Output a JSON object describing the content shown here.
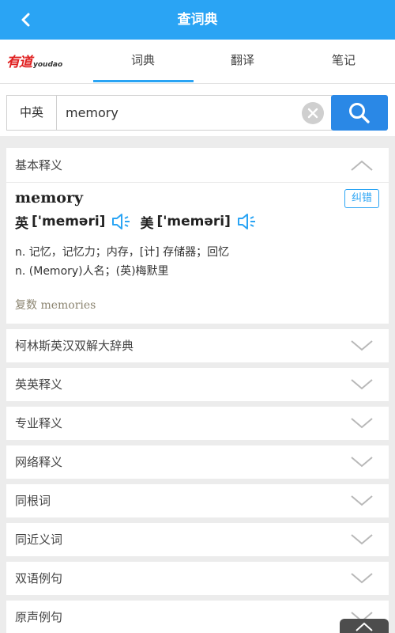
{
  "header": {
    "title": "查词典"
  },
  "tabs": {
    "logo_cn": "有道",
    "logo_en": "youdao",
    "items": [
      "词典",
      "翻译",
      "笔记"
    ],
    "active_index": 0
  },
  "search": {
    "lang": "中英",
    "query": "memory"
  },
  "basic": {
    "section_label": "基本释义",
    "word": "memory",
    "report_label": "纠错",
    "uk_label": "英",
    "uk_phonetic": "['meməri]",
    "us_label": "美",
    "us_phonetic": "['meməri]",
    "def1": "n. 记忆，记忆力；内存，[计] 存储器；回忆",
    "def2": "n. (Memory)人名；(英)梅默里",
    "plural": "复数 memories"
  },
  "sections": [
    "柯林斯英汉双解大辞典",
    "英英释义",
    "专业释义",
    "网络释义",
    "同根词",
    "同近义词",
    "双语例句",
    "原声例句"
  ],
  "colors": {
    "accent": "#2aa4f4",
    "search_button": "#2a88e6"
  },
  "icons": [
    "back-arrow-icon",
    "clear-icon",
    "search-icon",
    "speaker-icon",
    "chevron-up-icon",
    "chevron-down-icon",
    "scroll-top-icon"
  ]
}
